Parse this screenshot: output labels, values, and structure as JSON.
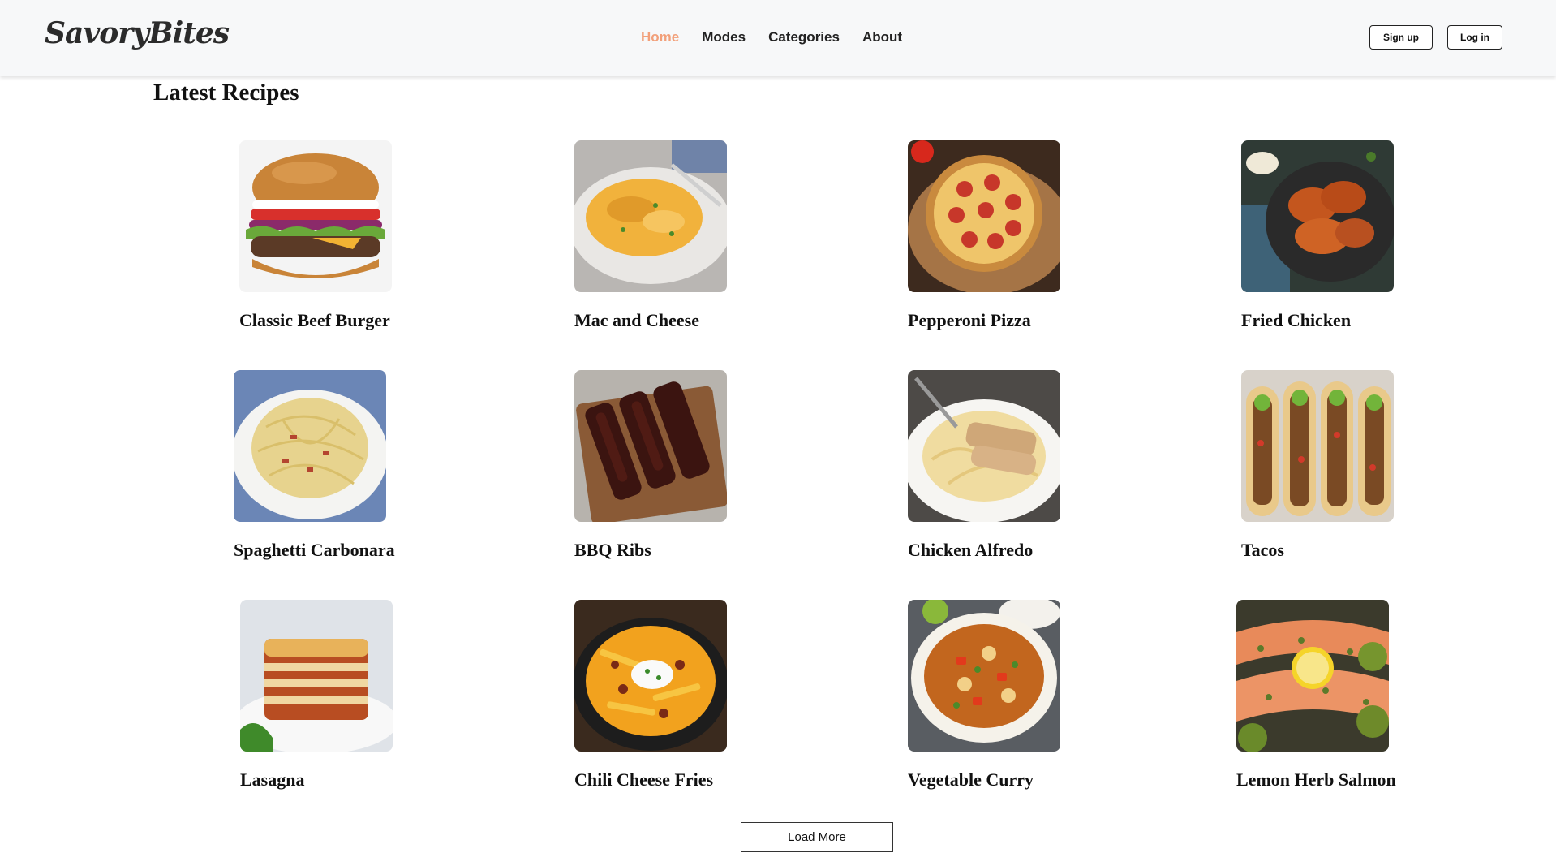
{
  "brand": {
    "logo_text": "SavoryBites"
  },
  "nav": {
    "links": [
      {
        "label": "Home",
        "active": true
      },
      {
        "label": "Modes",
        "active": false
      },
      {
        "label": "Categories",
        "active": false
      },
      {
        "label": "About",
        "active": false
      }
    ],
    "active_color": "#f2a07a"
  },
  "auth": {
    "signup_label": "Sign up",
    "login_label": "Log in"
  },
  "main": {
    "section_title": "Latest Recipes",
    "recipes": [
      {
        "title": "Classic Beef Burger",
        "image": "burger-photo"
      },
      {
        "title": "Mac and Cheese",
        "image": "mac-and-cheese-photo"
      },
      {
        "title": "Pepperoni Pizza",
        "image": "pepperoni-pizza-photo"
      },
      {
        "title": "Fried Chicken",
        "image": "fried-chicken-photo"
      },
      {
        "title": "Spaghetti Carbonara",
        "image": "spaghetti-carbonara-photo"
      },
      {
        "title": "BBQ Ribs",
        "image": "bbq-ribs-photo"
      },
      {
        "title": "Chicken Alfredo",
        "image": "chicken-alfredo-photo"
      },
      {
        "title": "Tacos",
        "image": "tacos-photo"
      },
      {
        "title": "Lasagna",
        "image": "lasagna-photo"
      },
      {
        "title": "Chili Cheese Fries",
        "image": "chili-cheese-fries-photo"
      },
      {
        "title": "Vegetable Curry",
        "image": "vegetable-curry-photo"
      },
      {
        "title": "Lemon Herb Salmon",
        "image": "lemon-herb-salmon-photo"
      }
    ],
    "load_more_label": "Load More"
  }
}
